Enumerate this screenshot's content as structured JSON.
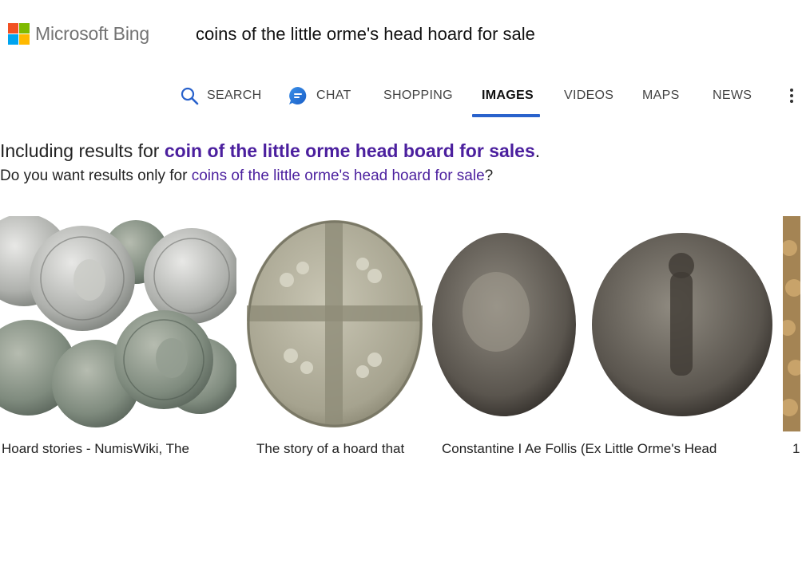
{
  "header": {
    "logo_text": "Microsoft Bing",
    "query": "coins of the little orme's head hoard for sale"
  },
  "tabs": [
    {
      "label": "SEARCH"
    },
    {
      "label": "CHAT"
    },
    {
      "label": "SHOPPING"
    },
    {
      "label": "IMAGES",
      "active": true
    },
    {
      "label": "VIDEOS"
    },
    {
      "label": "MAPS"
    },
    {
      "label": "NEWS"
    }
  ],
  "spelling": {
    "including_prefix": "Including results for ",
    "corrected_query": "coin of the little orme head board for sales",
    "including_suffix": ".",
    "only_prefix": "Do you want results only for ",
    "original_query": "coins of the little orme's head hoard for sale",
    "only_suffix": "?"
  },
  "results": [
    {
      "caption": "Hoard stories - NumisWiki, The"
    },
    {
      "caption": "The story of a hoard that"
    },
    {
      "caption": "Constantine I Ae Follis (Ex Little Orme's Head"
    },
    {
      "caption": "1"
    }
  ],
  "colors": {
    "accent": "#2962cc",
    "link_purple": "#4b1f9e",
    "ms_red": "#f25022",
    "ms_green": "#7fba00",
    "ms_blue": "#00a4ef",
    "ms_yellow": "#ffb900"
  }
}
